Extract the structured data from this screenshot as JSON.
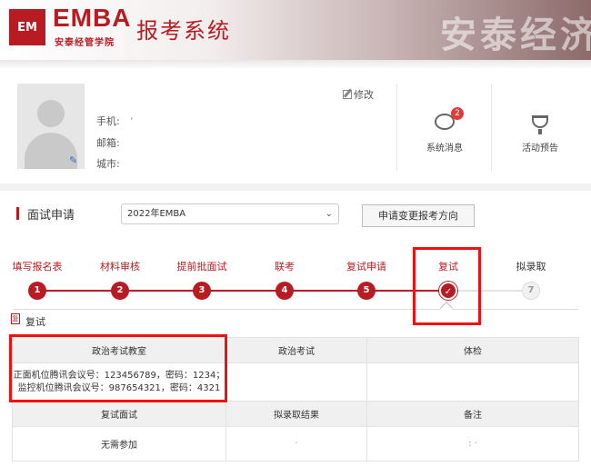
{
  "header": {
    "logo_text": "EMBA",
    "logo_mark": "EM",
    "logo_subtitle": "安泰经管学院",
    "system_title": "报考系统",
    "watermark": "安泰经济"
  },
  "profile": {
    "edit_label": "修改",
    "phone_label": "手机:",
    "email_label": "邮箱:",
    "city_label": "城市:",
    "phone_value": "'"
  },
  "tools": {
    "messages_label": "系统消息",
    "messages_badge": "2",
    "events_label": "活动预告"
  },
  "interview": {
    "section_title": "面试申请",
    "select_value": "2022年EMBA",
    "change_button": "申请变更报考方向"
  },
  "steps": [
    {
      "label": "填写报名表",
      "num": "1"
    },
    {
      "label": "材料审核",
      "num": "2"
    },
    {
      "label": "提前批面试",
      "num": "3"
    },
    {
      "label": "联考",
      "num": "4"
    },
    {
      "label": "复试申请",
      "num": "5"
    },
    {
      "label": "复试",
      "num": "✓"
    },
    {
      "label": "拟录取",
      "num": "7"
    }
  ],
  "retest": {
    "title": "复试",
    "icon_text": "复",
    "headers1": [
      "政治考试教室",
      "政治考试",
      "体检"
    ],
    "row1": {
      "room_line1": "正面机位腾讯会议号：123456789，密码：1234；",
      "room_line2": "监控机位腾讯会议号：987654321，密码：4321",
      "politics": "",
      "physical": ""
    },
    "headers2": [
      "复试面试",
      "拟录取结果",
      "备注"
    ],
    "row2": {
      "interview": "无需参加",
      "result": "·",
      "note": ": ·"
    }
  }
}
